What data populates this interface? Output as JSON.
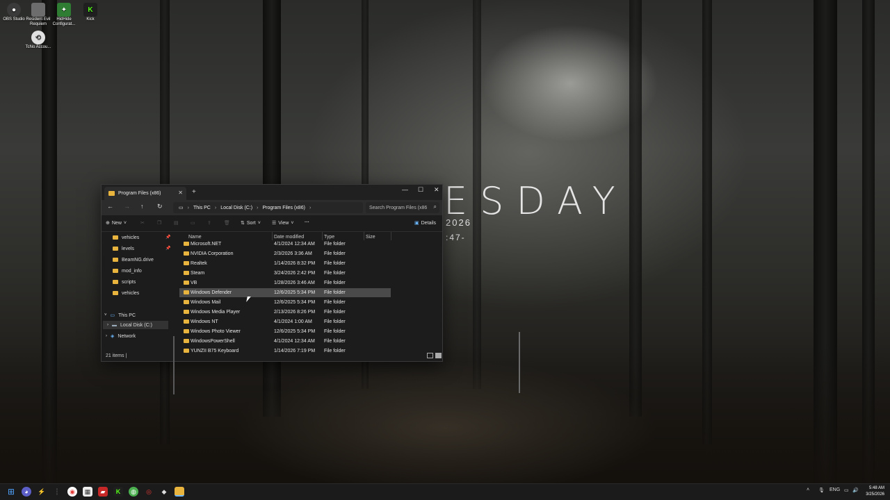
{
  "desktop": {
    "icons": [
      {
        "label": "OBS Studio",
        "color": "#3a3a3a"
      },
      {
        "label": "Resident Evil Requiem",
        "color": "#6d6d6d"
      },
      {
        "label": "HidHide Configurat...",
        "color": "#2f7d32"
      },
      {
        "label": "Kick",
        "color": "#1f1f1f"
      },
      {
        "label": "TcNo Accou...",
        "color": "#e0e0e0"
      }
    ],
    "widget": {
      "day": "ESDAY",
      "date": "R 2026",
      "time": ":47-"
    }
  },
  "explorer": {
    "tab_title": "Program Files (x86)",
    "breadcrumbs": [
      "This PC",
      "Local Disk (C:)",
      "Program Files (x86)"
    ],
    "search_placeholder": "Search Program Files (x86",
    "commands": {
      "new": "New",
      "sort": "Sort",
      "view": "View",
      "more": "···",
      "details": "Details"
    },
    "sidebar": {
      "quick": [
        "vehicles",
        "levels",
        "BeamNG.drive",
        "mod_info",
        "scripts",
        "vehicles"
      ],
      "this_pc": "This PC",
      "local_disk": "Local Disk (C:)",
      "network": "Network"
    },
    "columns": {
      "name": "Name",
      "date": "Date modified",
      "type": "Type",
      "size": "Size"
    },
    "rows": [
      {
        "name": "Microsoft.NET",
        "date": "4/1/2024 12:34 AM",
        "type": "File folder"
      },
      {
        "name": "NVIDIA Corporation",
        "date": "2/3/2026 3:36 AM",
        "type": "File folder"
      },
      {
        "name": "Realtek",
        "date": "1/14/2026 8:32 PM",
        "type": "File folder"
      },
      {
        "name": "Steam",
        "date": "3/24/2026 2:42 PM",
        "type": "File folder"
      },
      {
        "name": "VB",
        "date": "1/28/2026 3:46 AM",
        "type": "File folder"
      },
      {
        "name": "Windows Defender",
        "date": "12/6/2025 5:34 PM",
        "type": "File folder"
      },
      {
        "name": "Windows Mail",
        "date": "12/6/2025 5:34 PM",
        "type": "File folder"
      },
      {
        "name": "Windows Media Player",
        "date": "2/13/2026 8:26 PM",
        "type": "File folder"
      },
      {
        "name": "Windows NT",
        "date": "4/1/2024 1:00 AM",
        "type": "File folder"
      },
      {
        "name": "Windows Photo Viewer",
        "date": "12/6/2025 5:34 PM",
        "type": "File folder"
      },
      {
        "name": "WindowsPowerShell",
        "date": "4/1/2024 12:34 AM",
        "type": "File folder"
      },
      {
        "name": "YUNZII B75 Keyboard",
        "date": "1/14/2026 7:19 PM",
        "type": "File folder"
      }
    ],
    "selected_row": "Windows Defender",
    "status": "21 items  |"
  },
  "taskbar": {
    "language": "ENG",
    "time": "5:48 AM",
    "date": "3/25/2026"
  }
}
